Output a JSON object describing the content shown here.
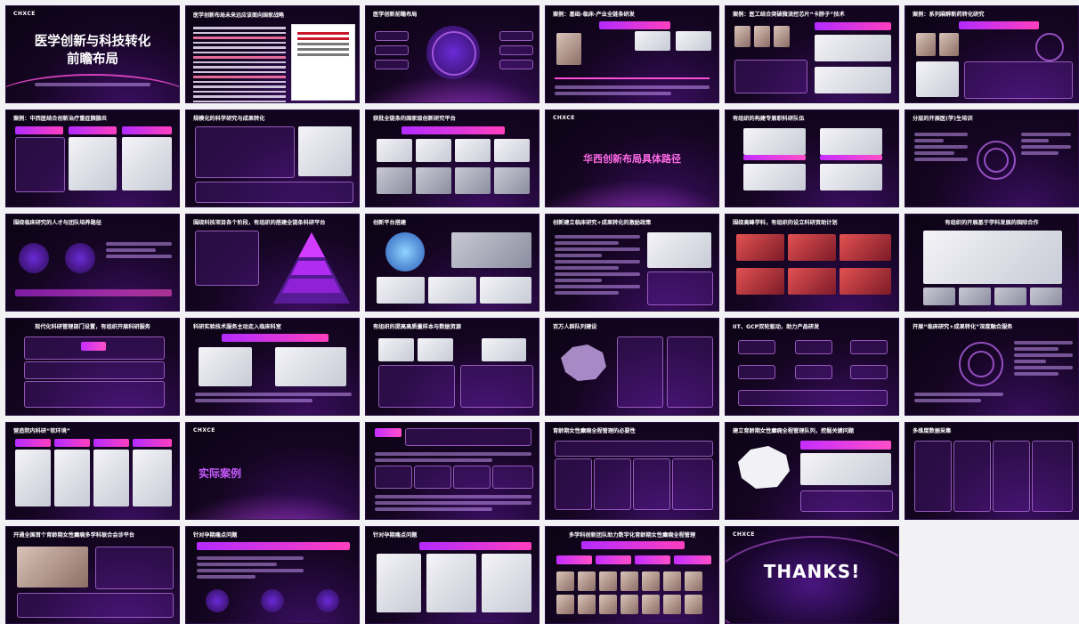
{
  "slides": [
    {
      "title": "",
      "type": "cover",
      "cover_title_line1": "医学创新与科技转化",
      "cover_title_line2": "前瞻布局"
    },
    {
      "title": "医学创新布局未来远应该面向国家战略",
      "type": "doc"
    },
    {
      "title": "医学创新前瞻布局",
      "type": "hub"
    },
    {
      "title": "案例：基础-临床-产业全链条研发",
      "type": "timeline"
    },
    {
      "title": "案例：医工结合突破微流控芯片“卡脖子”技术",
      "type": "photos"
    },
    {
      "title": "案例：系列麻醉新药转化研究",
      "type": "photos"
    },
    {
      "title": "案例：中西医结合创新治疗重症胰腺炎",
      "type": "columns"
    },
    {
      "title": "规模化的科学研究与成果转化",
      "type": "table"
    },
    {
      "title": "获批全链条的国家级创新研究平台",
      "type": "platform"
    },
    {
      "title": "",
      "type": "section",
      "section_text": "华西创新布局具体路径"
    },
    {
      "title": "有组织的构建专兼职科研队伍",
      "type": "flow"
    },
    {
      "title": "分层的开展医(学)生培训",
      "type": "rings"
    },
    {
      "title": "围绕临床研究的人才与团队培养路径",
      "type": "chevrons"
    },
    {
      "title": "围绕科技项目各个阶段，有组织的搭建全链条科研平台",
      "type": "pyramid"
    },
    {
      "title": "创新平台搭建",
      "type": "globe"
    },
    {
      "title": "创新建立临床研究+成果转化的激励政策",
      "type": "list"
    },
    {
      "title": "围绕高峰学科，有组织的设立科研资助计划",
      "type": "photos-grid"
    },
    {
      "title": "有组织的开展基于学科发展的国际合作",
      "type": "map"
    },
    {
      "title": "现代化科研管理部门设置，有组织开展科研服务",
      "type": "org"
    },
    {
      "title": "科研实验技术服务主动走入临床科室",
      "type": "screens"
    },
    {
      "title": "有组织的提高高质量样本与数据资源",
      "type": "cards"
    },
    {
      "title": "百万人群队列建设",
      "type": "china-map"
    },
    {
      "title": "IIT、GCP双轮驱动，助力产品研发",
      "type": "flowchart"
    },
    {
      "title": "开展“临床研究+成果转化”深度融合服务",
      "type": "circle-flow"
    },
    {
      "title": "营造院内科研“软环境”",
      "type": "columns"
    },
    {
      "title": "",
      "type": "section2",
      "section_text": "实际案例"
    },
    {
      "title": "",
      "type": "stats"
    },
    {
      "title": "育龄期女性癫痫全程管理的必要性",
      "type": "grid-cards"
    },
    {
      "title": "建立育龄期女性癫痫全程管理队列，挖掘关键问题",
      "type": "china-map2"
    },
    {
      "title": "多维度数据采集",
      "type": "data-columns"
    },
    {
      "title": "开通全国首个育龄期女性癫痫多学科联合会诊平台",
      "type": "meeting"
    },
    {
      "title": "针对孕期痛点问题",
      "type": "hex"
    },
    {
      "title": "针对孕期痛点问题",
      "type": "diagram"
    },
    {
      "title": "多学科创新团队助力数字化育龄期女性癫痫全程管理",
      "type": "team"
    },
    {
      "title": "",
      "type": "thanks",
      "thanks_text": "THANKS!"
    }
  ],
  "brand": {
    "logo": "CHXCE"
  },
  "colors": {
    "accent": "#ff4fd8",
    "bg": "#150523",
    "purple": "#9b2bff"
  }
}
